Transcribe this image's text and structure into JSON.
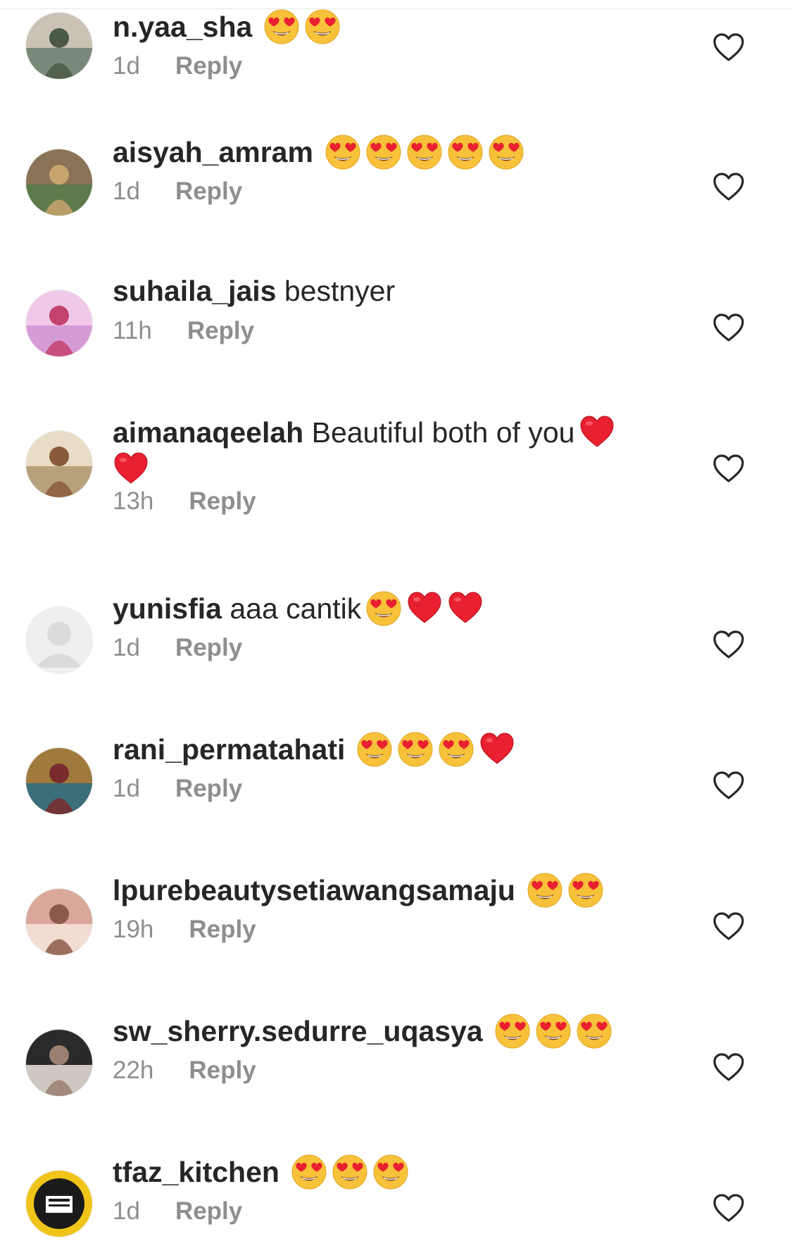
{
  "comments": [
    {
      "username": "n.yaa_sha",
      "text": "",
      "emojis": [
        "heart-eyes",
        "heart-eyes"
      ],
      "trailing_emojis": [],
      "time": "1d",
      "reply_label": "Reply",
      "avatar_colors": [
        "#7a8a7a",
        "#c9c2b5",
        "#4b5a48"
      ]
    },
    {
      "username": "aisyah_amram",
      "text": "",
      "emojis": [
        "heart-eyes",
        "heart-eyes",
        "heart-eyes",
        "heart-eyes",
        "heart-eyes"
      ],
      "trailing_emojis": [],
      "time": "1d",
      "reply_label": "Reply",
      "avatar_colors": [
        "#5d7a4a",
        "#8a7356",
        "#c9a56e"
      ]
    },
    {
      "username": "suhaila_jais",
      "text": "bestnyer",
      "emojis": [],
      "trailing_emojis": [],
      "time": "11h",
      "reply_label": "Reply",
      "avatar_colors": [
        "#d69bd6",
        "#f0c9e8",
        "#c4426e"
      ]
    },
    {
      "username": "aimanaqeelah",
      "text": "Beautiful both of you",
      "emojis": [
        "red-heart"
      ],
      "trailing_emojis": [
        "red-heart"
      ],
      "time": "13h",
      "reply_label": "Reply",
      "avatar_colors": [
        "#b8a27d",
        "#e8dcc6",
        "#8a5a3c"
      ]
    },
    {
      "username": "yunisfia",
      "text": "aaa cantik",
      "emojis": [
        "heart-eyes",
        "red-heart",
        "red-heart"
      ],
      "trailing_emojis": [],
      "time": "1d",
      "reply_label": "Reply",
      "avatar_colors": [
        "#efefef",
        "#dbdbdb",
        "#ffffff"
      ]
    },
    {
      "username": "rani_permatahati",
      "text": "",
      "emojis": [
        "heart-eyes",
        "heart-eyes",
        "heart-eyes",
        "red-heart"
      ],
      "trailing_emojis": [],
      "time": "1d",
      "reply_label": "Reply",
      "avatar_colors": [
        "#3a6e78",
        "#a07a3c",
        "#7a2b2b"
      ]
    },
    {
      "username": "lpurebeautysetiawangsamaju",
      "text": "",
      "emojis": [
        "heart-eyes",
        "heart-eyes"
      ],
      "trailing_emojis": [],
      "time": "19h",
      "reply_label": "Reply",
      "avatar_colors": [
        "#f3dcd2",
        "#d9a89a",
        "#8c5a4a"
      ]
    },
    {
      "username": "sw_sherry.sedurre_uqasya",
      "text": "",
      "emojis": [
        "heart-eyes",
        "heart-eyes",
        "heart-eyes"
      ],
      "trailing_emojis": [],
      "time": "22h",
      "reply_label": "Reply",
      "avatar_colors": [
        "#cfc8c0",
        "#2a2a2a",
        "#9a8070"
      ]
    },
    {
      "username": "tfaz_kitchen",
      "text": "",
      "emojis": [
        "heart-eyes",
        "heart-eyes",
        "heart-eyes"
      ],
      "trailing_emojis": [],
      "time": "1d",
      "reply_label": "Reply",
      "avatar_colors": [
        "#f0c419",
        "#1a1a1a",
        "#ffffff"
      ]
    }
  ],
  "colors": {
    "username": "#262626",
    "meta": "#8e8e8e",
    "heart_outline": "#262626",
    "emoji_face": "#f7c13a",
    "emoji_heart": "#e8202f"
  }
}
